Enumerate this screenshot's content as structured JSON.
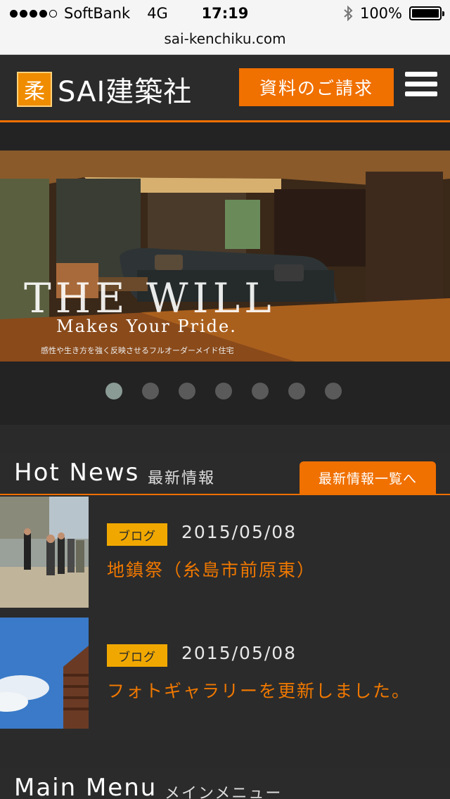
{
  "status_bar": {
    "carrier": "SoftBank",
    "network": "4G",
    "time": "17:19",
    "battery": "100%"
  },
  "browser": {
    "url": "sai-kenchiku.com"
  },
  "header": {
    "logo_mark": "柔",
    "logo_text": "SAI建築社",
    "request_button": "資料のご請求",
    "menu_icon": "hamburger-menu-icon"
  },
  "hero": {
    "title": "THE WILL",
    "subtitle": "Makes Your Pride.",
    "caption": "感性や生き方を強く反映させるフルオーダーメイド住宅",
    "slide_count": 7,
    "active_slide": 1
  },
  "hot_news": {
    "title": "Hot News",
    "subtitle": "最新情報",
    "more_link": "最新情報一覧へ",
    "items": [
      {
        "tag": "ブログ",
        "date": "2015/05/08",
        "title": "地鎮祭（糸島市前原東）"
      },
      {
        "tag": "ブログ",
        "date": "2015/05/08",
        "title": "フォトギャラリーを更新しました。"
      }
    ]
  },
  "main_menu": {
    "title": "Main Menu",
    "subtitle": "メインメニュー"
  },
  "colors": {
    "accent": "#f07000",
    "tag": "#f0a800",
    "background": "#2b2b2b"
  }
}
